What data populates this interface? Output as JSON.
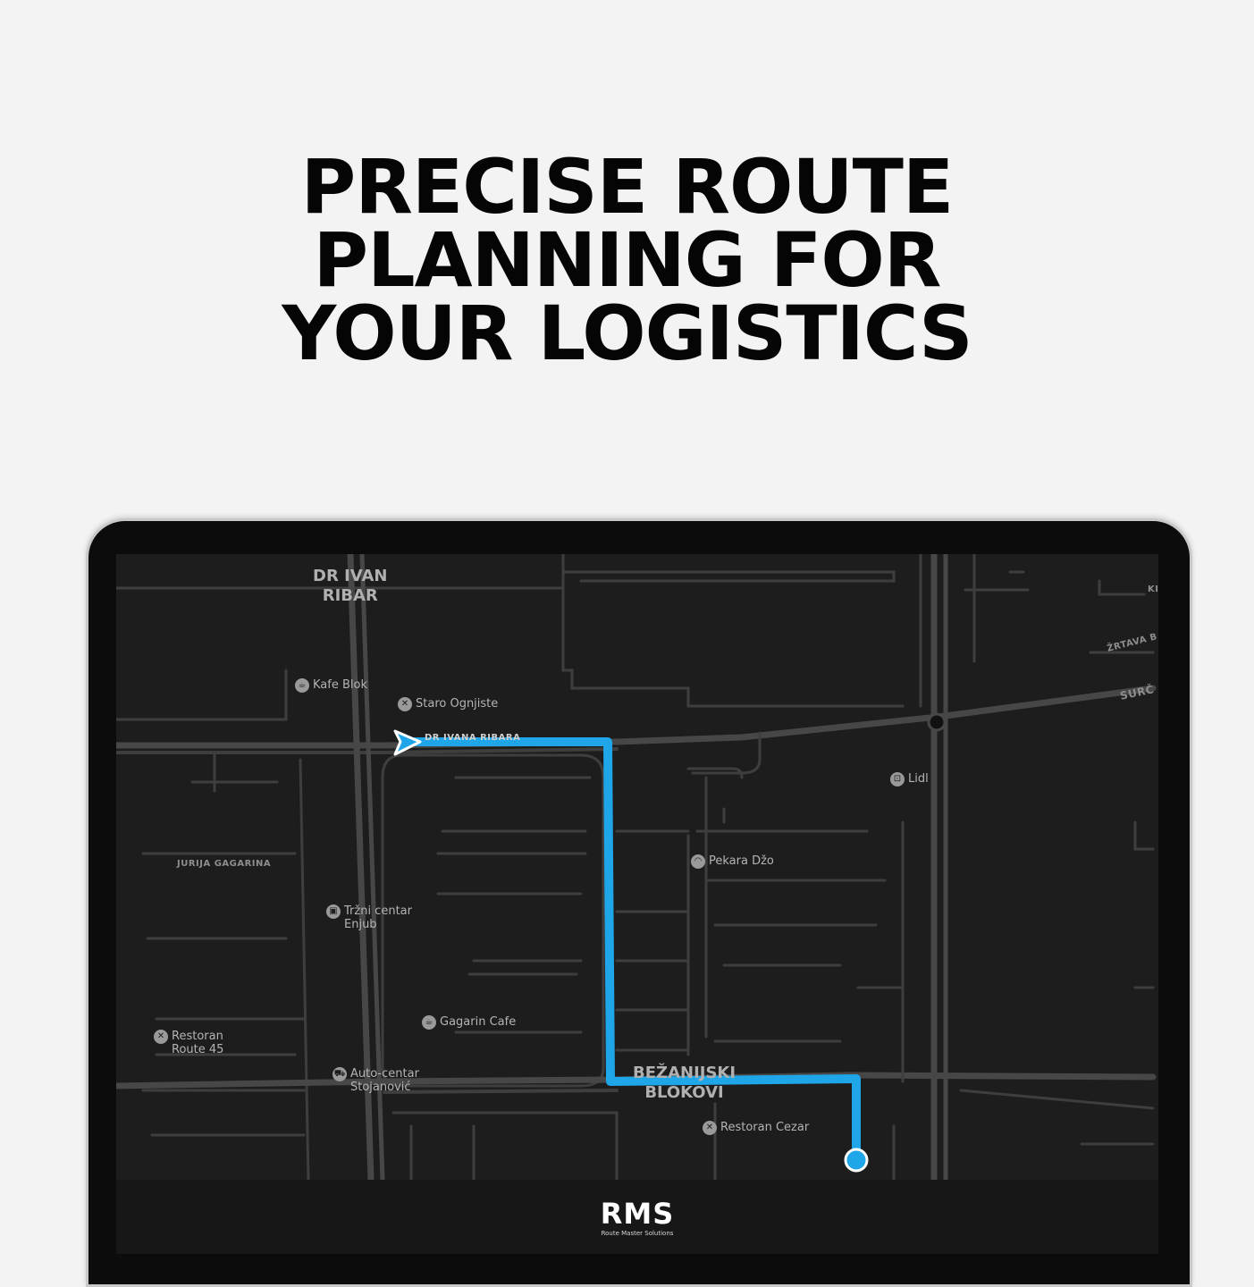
{
  "headline": {
    "line1": "PRECISE ROUTE",
    "line2": "PLANNING FOR",
    "line3": "YOUR LOGISTICS"
  },
  "map": {
    "districts": {
      "dr_ivan_ribar_1": "DR IVAN",
      "dr_ivan_ribar_2": "RIBAR",
      "bezanijski_1": "BEŽANIJSKI",
      "bezanijski_2": "BLOKOVI"
    },
    "streets": {
      "jurija_gagarina": "JURIJA GAGARINA",
      "dr_ivana_ribara": "DR IVANA RIBARA",
      "zrtava": "ŽRTAVA B",
      "surc": "SURČ",
      "ki": "KI"
    },
    "pois": {
      "kafe_blok": "Kafe Blok",
      "staro_ognjiste": "Staro Ognjiste",
      "lidl": "Lidl",
      "pekara_dzo": "Pekara Džo",
      "trzni_centar_1": "Tržni centar",
      "trzni_centar_2": "Enjub",
      "gagarin_cafe": "Gagarin Cafe",
      "restoran_route45_1": "Restoran",
      "restoran_route45_2": "Route 45",
      "auto_centar_1": "Auto-centar",
      "auto_centar_2": "Stojanović",
      "restoran_cezar": "Restoran Cezar"
    },
    "colors": {
      "route": "#1fa6e8",
      "road": "#3e3e3e",
      "background": "#1d1d1d"
    }
  },
  "brand": {
    "logo": "RMS",
    "tagline": "Route Master Solutions"
  }
}
